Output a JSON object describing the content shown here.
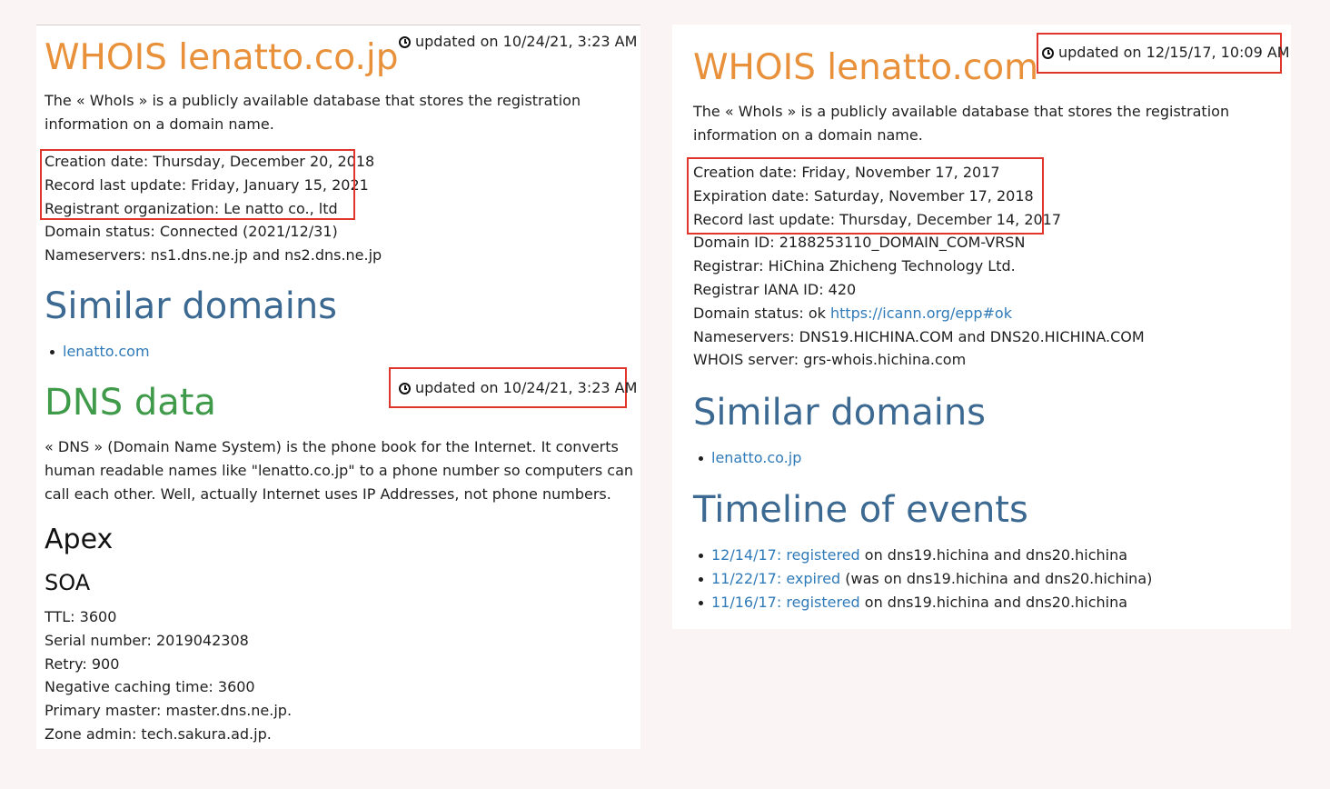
{
  "left": {
    "title": "WHOIS lenatto.co.jp",
    "updated_top": "updated on 10/24/21, 3:23 AM",
    "intro_line1": "The « WhoIs » is a publicly available database that stores the registration",
    "intro_line2": "information on a domain name.",
    "whois_fields": [
      "Creation date: Thursday, December 20, 2018",
      "Record last update: Friday, January 15, 2021",
      "Registrant organization: Le natto co., ltd",
      "Domain status: Connected (2021/12/31)",
      "Nameservers: ns1.dns.ne.jp and ns2.dns.ne.jp"
    ],
    "similar_heading": "Similar domains",
    "similar_items": [
      "lenatto.com"
    ],
    "dns_heading": "DNS data",
    "updated_dns": "updated on 10/24/21, 3:23 AM",
    "dns_text": [
      "« DNS » (Domain Name System) is the phone book for the Internet. It converts",
      "human readable names like \"lenatto.co.jp\" to a phone number so computers can",
      "call each other. Well, actually Internet uses IP Addresses, not phone numbers."
    ],
    "apex_heading": "Apex",
    "soa_heading": "SOA",
    "soa_fields": [
      "TTL: 3600",
      "Serial number: 2019042308",
      "Retry: 900",
      "Negative caching time: 3600",
      "Primary master: master.dns.ne.jp.",
      "Zone admin: tech.sakura.ad.jp."
    ]
  },
  "right": {
    "title": "WHOIS lenatto.com",
    "updated_top": "updated on 12/15/17, 10:09 AM",
    "intro_line1": "The « WhoIs » is a publicly available database that stores the registration",
    "intro_line2": "information on a domain name.",
    "whois_fields": [
      "Creation date: Friday, November 17, 2017",
      "Expiration date: Saturday, November 17, 2018",
      "Record last update: Thursday, December 14, 2017",
      "Domain ID: 2188253110_DOMAIN_COM-VRSN",
      "Registrar: HiChina Zhicheng Technology Ltd.",
      "Registrar IANA ID: 420"
    ],
    "status_label": "Domain status: ok ",
    "status_link": "https://icann.org/epp#ok",
    "whois_fields_after": [
      "Nameservers: DNS19.HICHINA.COM and DNS20.HICHINA.COM",
      "WHOIS server: grs-whois.hichina.com"
    ],
    "similar_heading": "Similar domains",
    "similar_items": [
      "lenatto.co.jp"
    ],
    "timeline_heading": "Timeline of events",
    "timeline": [
      {
        "link": "12/14/17: registered",
        "rest": " on dns19.hichina and dns20.hichina"
      },
      {
        "link": "11/22/17: expired",
        "rest": " (was on dns19.hichina and dns20.hichina)"
      },
      {
        "link": "11/16/17: registered",
        "rest": " on dns19.hichina and dns20.hichina"
      }
    ]
  },
  "colors": {
    "highlight_box": "#e0352b",
    "title_orange": "#e8913a",
    "heading_blue": "#3c6991",
    "heading_green": "#3f9a4a",
    "link_blue": "#2f7ab8"
  }
}
